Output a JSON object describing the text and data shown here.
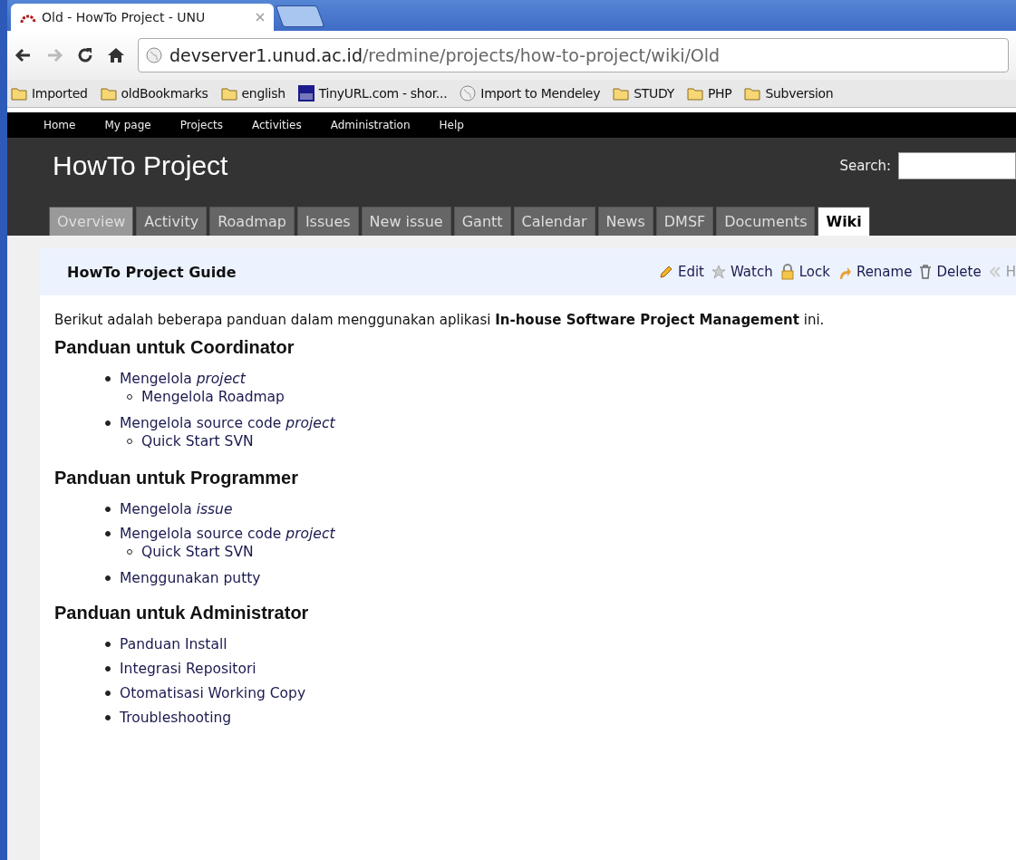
{
  "browser": {
    "tab_title": "Old - HowTo Project - UNU",
    "url_host": "devserver1.unud.ac.id",
    "url_path": "/redmine/projects/how-to-project/wiki/Old",
    "bookmarks": [
      {
        "label": "Imported",
        "kind": "folder"
      },
      {
        "label": "oldBookmarks",
        "kind": "folder"
      },
      {
        "label": "english",
        "kind": "folder"
      },
      {
        "label": "TinyURL.com - shor...",
        "kind": "tinyurl"
      },
      {
        "label": "Import to Mendeley",
        "kind": "globe"
      },
      {
        "label": "STUDY",
        "kind": "folder"
      },
      {
        "label": "PHP",
        "kind": "folder"
      },
      {
        "label": "Subversion",
        "kind": "folder"
      }
    ]
  },
  "top_menu": [
    "Home",
    "My page",
    "Projects",
    "Activities",
    "Administration",
    "Help"
  ],
  "project_title": "HowTo Project",
  "search": {
    "label": "Search:"
  },
  "tabs": [
    {
      "label": "Overview",
      "selected": false,
      "highlighted": true
    },
    {
      "label": "Activity",
      "selected": false,
      "highlighted": false
    },
    {
      "label": "Roadmap",
      "selected": false,
      "highlighted": false
    },
    {
      "label": "Issues",
      "selected": false,
      "highlighted": false
    },
    {
      "label": "New issue",
      "selected": false,
      "highlighted": false
    },
    {
      "label": "Gantt",
      "selected": false,
      "highlighted": false
    },
    {
      "label": "Calendar",
      "selected": false,
      "highlighted": false
    },
    {
      "label": "News",
      "selected": false,
      "highlighted": false
    },
    {
      "label": "DMSF",
      "selected": false,
      "highlighted": false
    },
    {
      "label": "Documents",
      "selected": false,
      "highlighted": false
    },
    {
      "label": "Wiki",
      "selected": true,
      "highlighted": false
    }
  ],
  "wiki": {
    "title": "HowTo Project Guide",
    "actions": [
      {
        "label": "Edit",
        "kind": "edit"
      },
      {
        "label": "Watch",
        "kind": "watch"
      },
      {
        "label": "Lock",
        "kind": "lock"
      },
      {
        "label": "Rename",
        "kind": "rename"
      },
      {
        "label": "Delete",
        "kind": "delete"
      },
      {
        "label": "H",
        "kind": "history"
      }
    ],
    "intro": "Berikut adalah beberapa panduan dalam menggunakan aplikasi **In-house Software Project Management** ini.",
    "sections": [
      {
        "heading": "Panduan untuk Coordinator",
        "items": [
          {
            "text": "Mengelola *project*",
            "children": [
              {
                "text": "Mengelola Roadmap"
              }
            ]
          },
          {
            "text": "Mengelola source code *project*",
            "children": [
              {
                "text": "Quick Start SVN"
              }
            ]
          }
        ]
      },
      {
        "heading": "Panduan untuk Programmer",
        "items": [
          {
            "text": "Mengelola *issue*"
          },
          {
            "text": "Mengelola source code *project*",
            "children": [
              {
                "text": "Quick Start SVN"
              }
            ]
          },
          {
            "text": "Menggunakan putty"
          }
        ]
      },
      {
        "heading": "Panduan untuk Administrator",
        "items": [
          {
            "text": "Panduan Install"
          },
          {
            "text": "Integrasi Repositori"
          },
          {
            "text": "Otomatisasi Working Copy"
          },
          {
            "text": "Troubleshooting"
          }
        ]
      }
    ]
  }
}
